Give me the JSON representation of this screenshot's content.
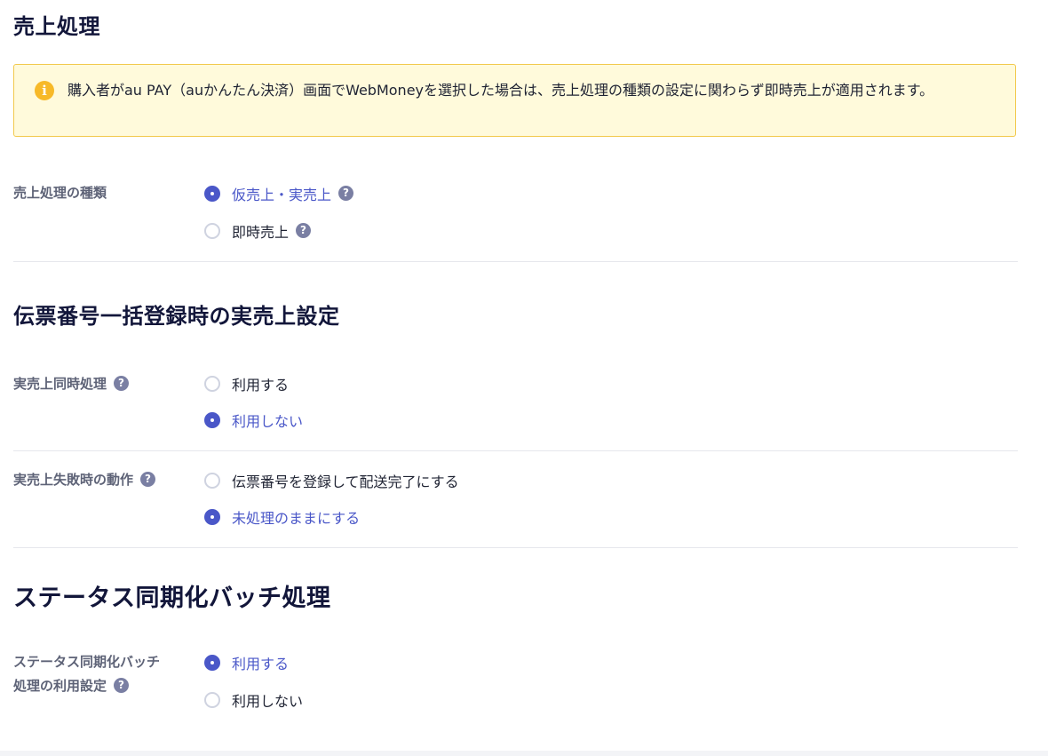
{
  "sales": {
    "title": "売上処理",
    "notice": "購入者がau PAY（auかんたん決済）画面でWebMoneyを選択した場合は、売上処理の種類の設定に関わらず即時売上が適用されます。",
    "type_label": "売上処理の種類",
    "options": [
      {
        "label": "仮売上・実売上",
        "selected": true
      },
      {
        "label": "即時売上",
        "selected": false
      }
    ]
  },
  "slip": {
    "title": "伝票番号一括登録時の実売上設定",
    "simultaneous_label": "実売上同時処理",
    "simultaneous_options": [
      {
        "label": "利用する",
        "selected": false
      },
      {
        "label": "利用しない",
        "selected": true
      }
    ],
    "failure_label": "実売上失敗時の動作",
    "failure_options": [
      {
        "label": "伝票番号を登録して配送完了にする",
        "selected": false
      },
      {
        "label": "未処理のままにする",
        "selected": true
      }
    ]
  },
  "batch": {
    "title": "ステータス同期化バッチ処理",
    "label_line1": "ステータス同期化バッチ",
    "label_line2": "処理の利用設定",
    "options": [
      {
        "label": "利用する",
        "selected": true
      },
      {
        "label": "利用しない",
        "selected": false
      }
    ]
  },
  "icons": {
    "help": "?",
    "info": "i"
  },
  "colors": {
    "accent": "#4a57c8",
    "notice_bg": "#fffadb",
    "notice_border": "#f2c94c",
    "info_icon": "#f7b928",
    "help_icon": "#7a7fa3"
  }
}
